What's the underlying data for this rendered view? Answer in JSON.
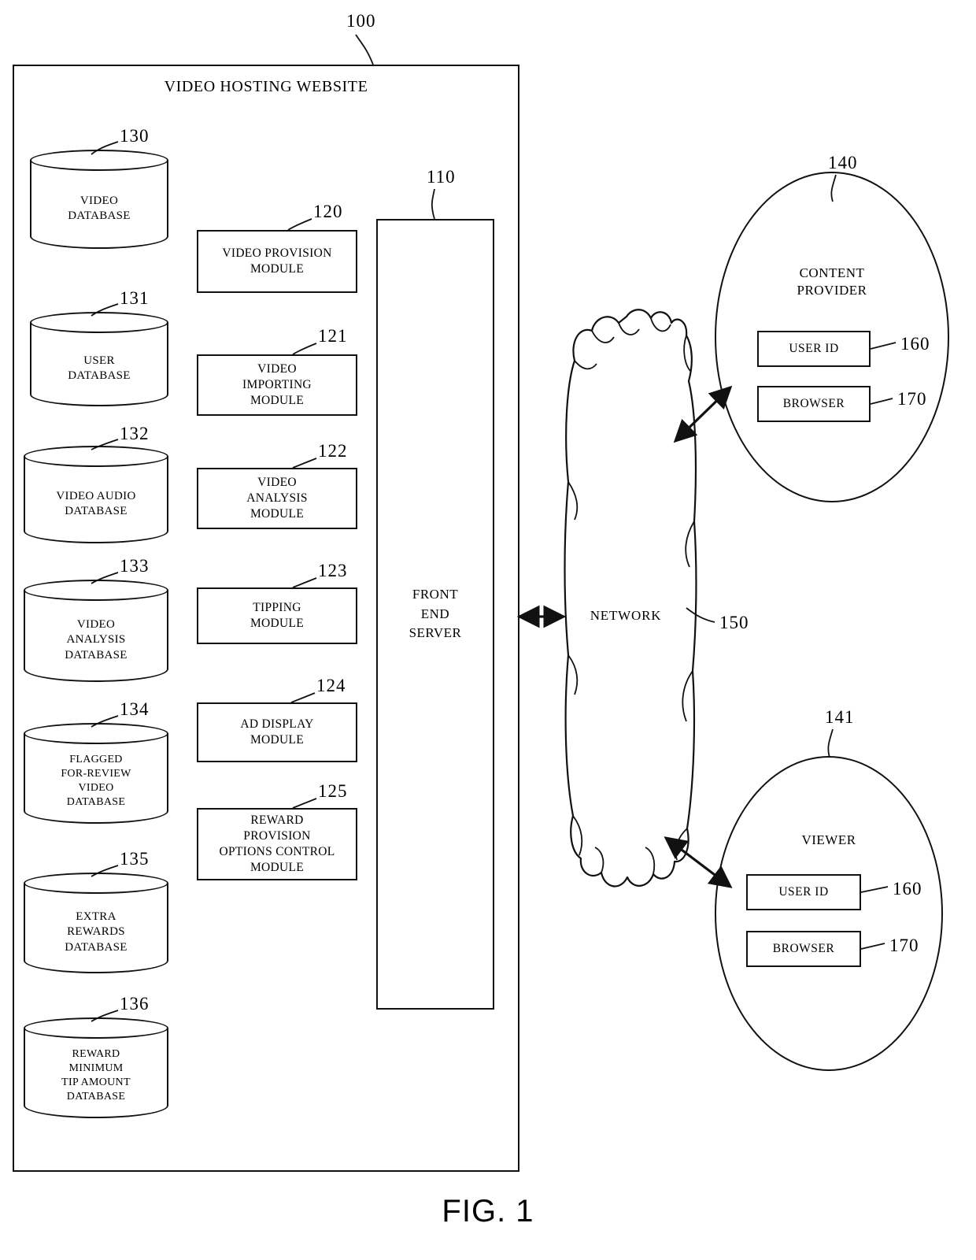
{
  "figure": {
    "caption": "FIG. 1",
    "system_ref": "100",
    "system_title": "VIDEO HOSTING WEBSITE"
  },
  "front_end_server": {
    "ref": "110",
    "label_lines": [
      "FRONT",
      "END",
      "SERVER"
    ]
  },
  "databases": [
    {
      "ref": "130",
      "lines": [
        "VIDEO",
        "DATABASE"
      ]
    },
    {
      "ref": "131",
      "lines": [
        "USER",
        "DATABASE"
      ]
    },
    {
      "ref": "132",
      "lines": [
        "VIDEO AUDIO",
        "DATABASE"
      ]
    },
    {
      "ref": "133",
      "lines": [
        "VIDEO",
        "ANALYSIS",
        "DATABASE"
      ]
    },
    {
      "ref": "134",
      "lines": [
        "FLAGGED",
        "FOR-REVIEW",
        "VIDEO",
        "DATABASE"
      ]
    },
    {
      "ref": "135",
      "lines": [
        "EXTRA",
        "REWARDS",
        "DATABASE"
      ]
    },
    {
      "ref": "136",
      "lines": [
        "REWARD",
        "MINIMUM",
        "TIP AMOUNT",
        "DATABASE"
      ]
    }
  ],
  "modules": [
    {
      "ref": "120",
      "lines": [
        "VIDEO PROVISION",
        "MODULE"
      ]
    },
    {
      "ref": "121",
      "lines": [
        "VIDEO",
        "IMPORTING",
        "MODULE"
      ]
    },
    {
      "ref": "122",
      "lines": [
        "VIDEO",
        "ANALYSIS",
        "MODULE"
      ]
    },
    {
      "ref": "123",
      "lines": [
        "TIPPING",
        "MODULE"
      ]
    },
    {
      "ref": "124",
      "lines": [
        "AD DISPLAY",
        "MODULE"
      ]
    },
    {
      "ref": "125",
      "lines": [
        "REWARD",
        "PROVISION",
        "OPTIONS CONTROL",
        "MODULE"
      ]
    }
  ],
  "network": {
    "ref": "150",
    "label": "NETWORK"
  },
  "endpoints": [
    {
      "ref": "140",
      "title": "CONTENT PROVIDER",
      "title_lines": [
        "CONTENT",
        "PROVIDER"
      ],
      "items": [
        {
          "ref": "160",
          "label": "USER ID"
        },
        {
          "ref": "170",
          "label": "BROWSER"
        }
      ]
    },
    {
      "ref": "141",
      "title": "VIEWER",
      "title_lines": [
        "VIEWER"
      ],
      "items": [
        {
          "ref": "160",
          "label": "USER ID"
        },
        {
          "ref": "170",
          "label": "BROWSER"
        }
      ]
    }
  ],
  "colors": {
    "line": "#111111",
    "background": "#ffffff"
  }
}
